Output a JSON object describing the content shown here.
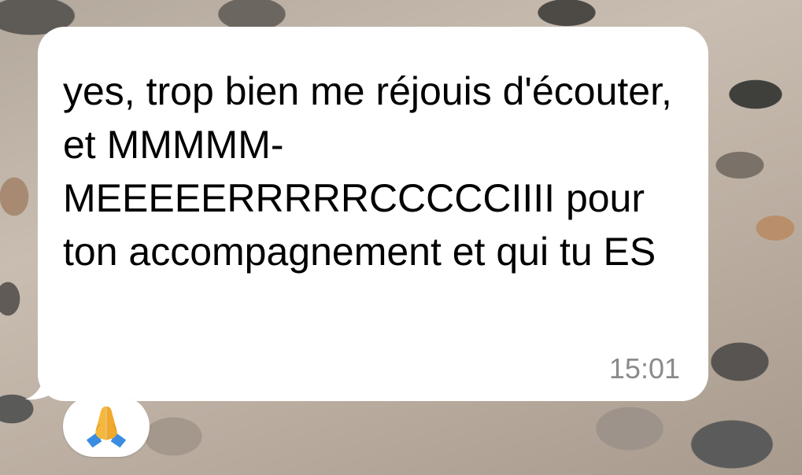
{
  "message": {
    "text": "yes, trop bien me réjouis d'écouter, et MMMMM-MEEEEERRRRRCCCCCIIII pour ton accompagnement et qui tu ES",
    "time": "15:01"
  },
  "reaction": {
    "icon": "folded-hands-icon"
  },
  "colors": {
    "bubble": "#ffffff",
    "text": "#000000",
    "timestamp": "#8a8a8e"
  }
}
